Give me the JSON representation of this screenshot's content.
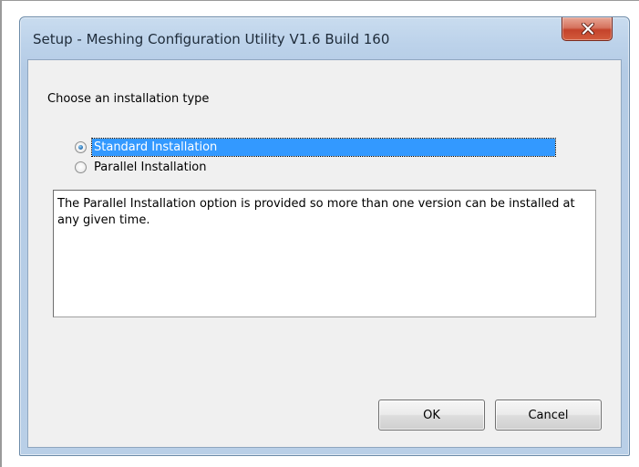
{
  "window": {
    "title": "Setup - Meshing Configuration Utility V1.6 Build 160"
  },
  "dialog": {
    "prompt": "Choose an installation type",
    "options": [
      {
        "label": "Standard Installation",
        "selected": true
      },
      {
        "label": "Parallel Installation",
        "selected": false
      }
    ],
    "description": "The Parallel Installation option is provided so more than one version can be installed at any given time.",
    "ok_label": "OK",
    "cancel_label": "Cancel"
  },
  "icons": {
    "close": "close-icon",
    "radio": "radio-button-icon"
  },
  "colors": {
    "selection": "#3399ff",
    "close_button": "#c4432b",
    "title_bar": "#bcd2ea"
  }
}
